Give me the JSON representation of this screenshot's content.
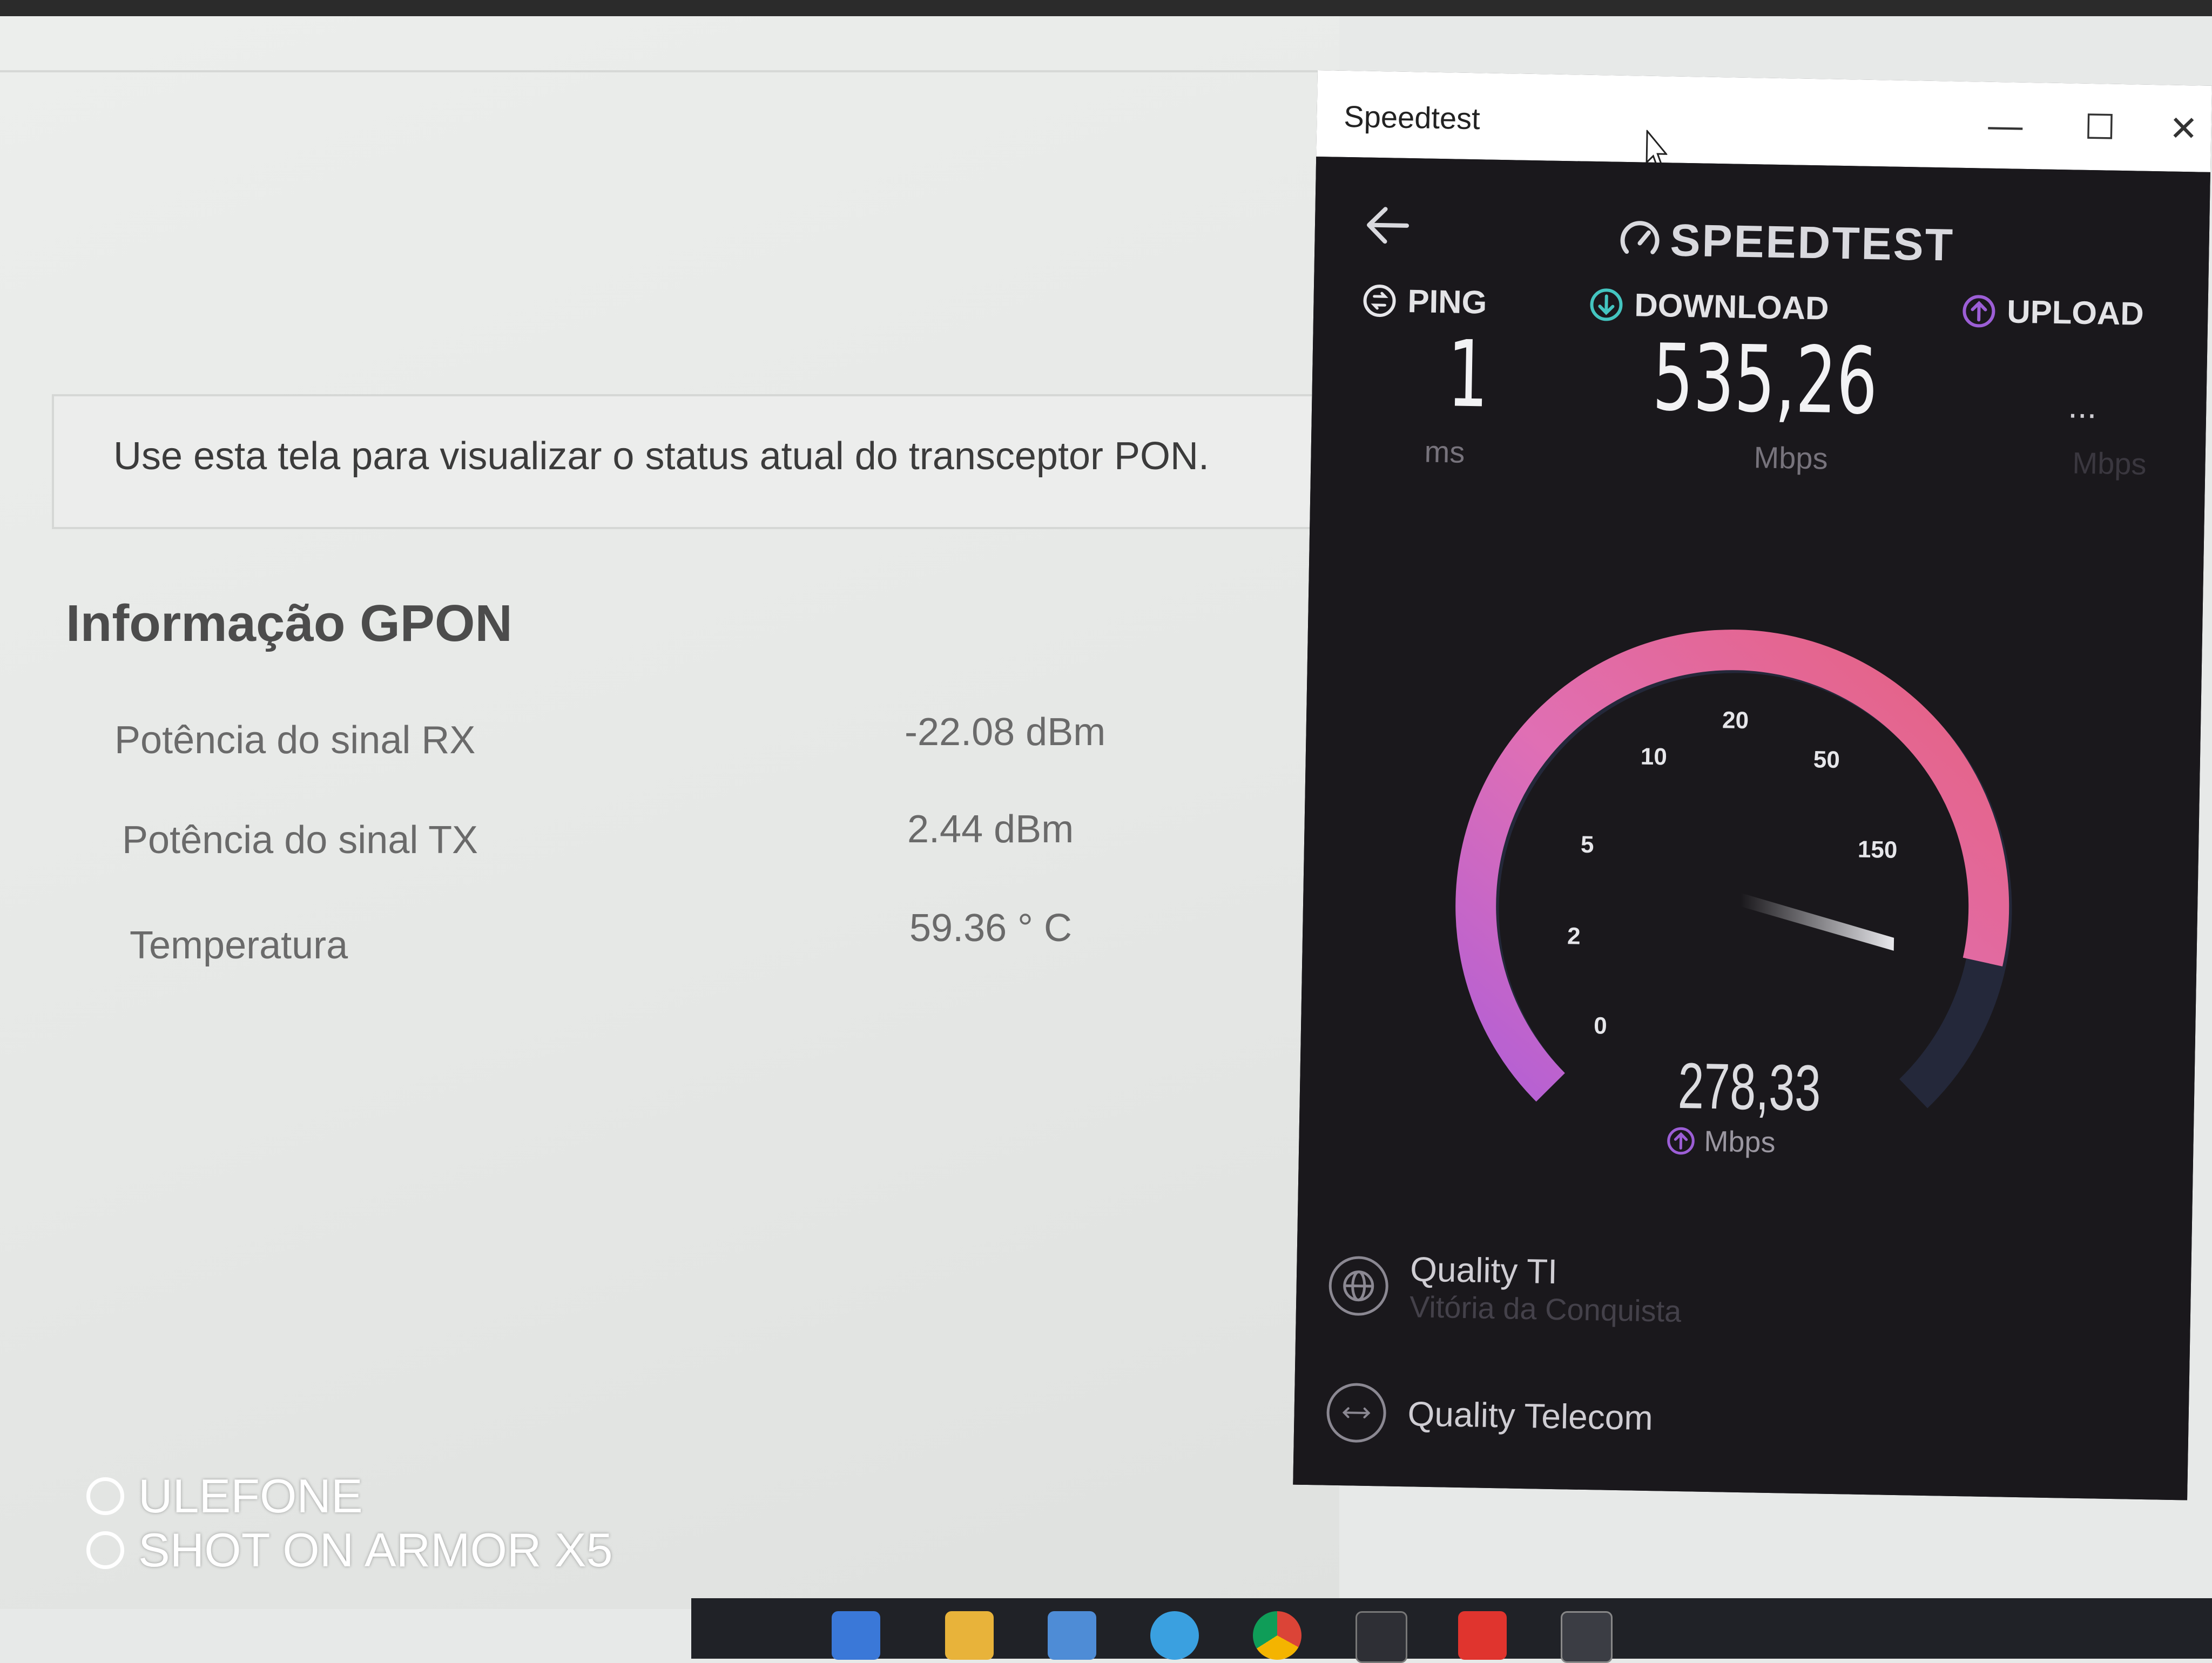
{
  "router_page": {
    "description": "Use esta tela para visualizar o status atual do transceptor PON.",
    "section_title": "Informação GPON",
    "rows": [
      {
        "label": "Potência do sinal RX",
        "value": "-22.08 dBm"
      },
      {
        "label": "Potência do sinal TX",
        "value": "2.44 dBm"
      },
      {
        "label": "Temperatura",
        "value": "59.36 ° C"
      }
    ]
  },
  "speedtest_window": {
    "title": "Speedtest",
    "controls": {
      "minimize": "—",
      "maximize": "☐",
      "close": "✕"
    },
    "logo_text": "SPEEDTEST",
    "ping": {
      "label": "PING",
      "value": "1",
      "unit": "ms"
    },
    "download": {
      "label": "DOWNLOAD",
      "value": "535,26",
      "unit": "Mbps"
    },
    "upload": {
      "label": "UPLOAD",
      "value": "...",
      "unit": "Mbps"
    },
    "gauge": {
      "ticks": [
        "0",
        "2",
        "5",
        "10",
        "20",
        "50",
        "150"
      ],
      "live_value": "278,33",
      "live_unit": "Mbps"
    },
    "servers": [
      {
        "name": "Quality TI",
        "location": "Vitória da Conquista"
      },
      {
        "name": "Quality Telecom",
        "location": ""
      }
    ],
    "colors": {
      "accent_pink": "#e6679e",
      "accent_purple": "#b25fd6",
      "ping_icon": "#e6e6ea",
      "download_icon": "#44c5c0",
      "upload_icon": "#9c5ed6"
    }
  },
  "watermark": {
    "line1": "ULEFONE",
    "line2": "SHOT ON ARMOR X5"
  },
  "taskbar_icons": [
    "start-icon",
    "edge-icon",
    "file-explorer-icon",
    "store-icon",
    "sync-icon",
    "chrome-icon",
    "speedtest-icon",
    "anydesk-icon",
    "terminal-icon"
  ]
}
